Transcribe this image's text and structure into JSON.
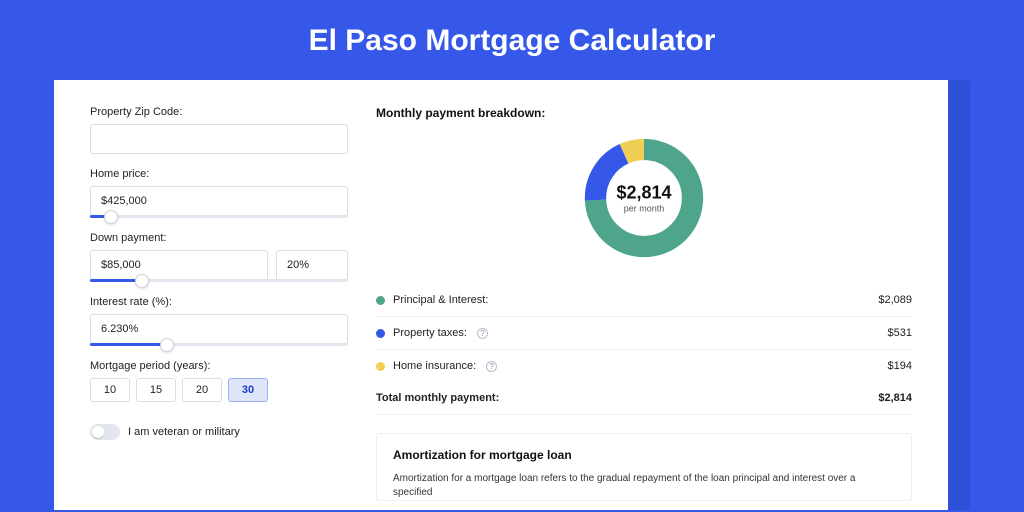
{
  "page": {
    "title": "El Paso Mortgage Calculator"
  },
  "form": {
    "zip": {
      "label": "Property Zip Code:",
      "value": ""
    },
    "home_price": {
      "label": "Home price:",
      "value": "$425,000",
      "slider_pct": 8
    },
    "down_payment": {
      "label": "Down payment:",
      "value": "$85,000",
      "pct_value": "20%",
      "slider_pct": 20
    },
    "interest": {
      "label": "Interest rate (%):",
      "value": "6.230%",
      "slider_pct": 30
    },
    "period": {
      "label": "Mortgage period (years):",
      "options": [
        "10",
        "15",
        "20",
        "30"
      ],
      "selected": "30"
    },
    "veteran": {
      "label": "I am veteran or military",
      "on": false
    }
  },
  "breakdown": {
    "title": "Monthly payment breakdown:",
    "donut": {
      "amount": "$2,814",
      "sub": "per month"
    },
    "items": [
      {
        "label": "Principal & Interest:",
        "amount": "$2,089",
        "color": "#4fa58b",
        "info": false
      },
      {
        "label": "Property taxes:",
        "amount": "$531",
        "color": "#3558e8",
        "info": true
      },
      {
        "label": "Home insurance:",
        "amount": "$194",
        "color": "#f1cf55",
        "info": true
      }
    ],
    "total": {
      "label": "Total monthly payment:",
      "amount": "$2,814"
    }
  },
  "chart_data": {
    "type": "pie",
    "title": "Monthly payment breakdown",
    "series": [
      {
        "name": "Principal & Interest",
        "value": 2089,
        "color": "#4fa58b"
      },
      {
        "name": "Property taxes",
        "value": 531,
        "color": "#3558e8"
      },
      {
        "name": "Home insurance",
        "value": 194,
        "color": "#f1cf55"
      }
    ],
    "total": 2814,
    "center_label": "$2,814",
    "center_sub": "per month"
  },
  "amort": {
    "title": "Amortization for mortgage loan",
    "text": "Amortization for a mortgage loan refers to the gradual repayment of the loan principal and interest over a specified"
  },
  "colors": {
    "brand": "#3558e8"
  }
}
